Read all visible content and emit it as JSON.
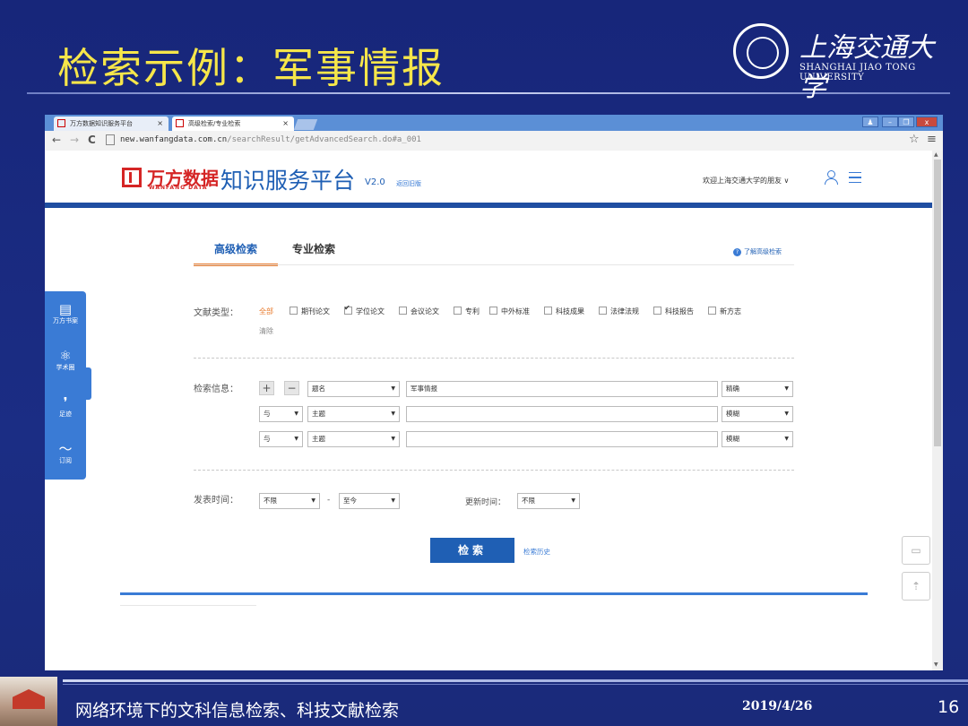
{
  "slide": {
    "title": "检索示例：军事情报",
    "logo_cn": "上海交通大学",
    "logo_en": "SHANGHAI JIAO TONG UNIVERSITY",
    "footer_text": "网络环境下的文科信息检索、科技文献检索",
    "footer_date": "2019/4/26",
    "page_number": "16"
  },
  "browser": {
    "tabs": [
      {
        "label": "万方数据知识服务平台",
        "close": "×"
      },
      {
        "label": "高级检索/专业检索",
        "close": "×"
      }
    ],
    "url_host": "new.wanfangdata.com.cn",
    "url_path": "/searchResult/getAdvancedSearch.do#a_001",
    "back": "←",
    "forward": "→",
    "reload": "C",
    "star": "☆",
    "menu": "≡"
  },
  "site": {
    "brand_cn": "万方数据",
    "brand_en": "WANFANG DATA",
    "platform": "知识服务平台",
    "version": "V2.0",
    "old_version_link": "返回旧版",
    "welcome": "欢迎上海交通大学的朋友 ∨"
  },
  "side_panel": {
    "items": [
      {
        "icon": "bookshelf-icon",
        "glyph": "▤",
        "label": "万方书案"
      },
      {
        "icon": "scholar-network-icon",
        "glyph": "⚛",
        "label": "学术圈"
      },
      {
        "icon": "footprint-icon",
        "glyph": "❜",
        "label": "足迹"
      },
      {
        "icon": "rss-icon",
        "glyph": "〜",
        "label": "订阅"
      }
    ]
  },
  "search_tabs": {
    "advanced": "高级检索",
    "professional": "专业检索",
    "help": "了解高级检索"
  },
  "doc_types": {
    "label": "文献类型：",
    "all": "全部",
    "clear": "清除",
    "options": [
      {
        "label": "期刊论文",
        "checked": false
      },
      {
        "label": "学位论文",
        "checked": true
      },
      {
        "label": "会议论文",
        "checked": false
      },
      {
        "label": "专利",
        "checked": false
      },
      {
        "label": "中外标准",
        "checked": false
      },
      {
        "label": "科技成果",
        "checked": false
      },
      {
        "label": "法律法规",
        "checked": false
      },
      {
        "label": "科技报告",
        "checked": false
      },
      {
        "label": "新方志",
        "checked": false
      }
    ]
  },
  "search_info": {
    "label": "检索信息：",
    "add": "+",
    "remove": "−",
    "rows": [
      {
        "logic": "",
        "field": "题名",
        "value": "军事情报",
        "match": "精确"
      },
      {
        "logic": "与",
        "field": "主题",
        "value": "",
        "match": "模糊"
      },
      {
        "logic": "与",
        "field": "主题",
        "value": "",
        "match": "模糊"
      }
    ]
  },
  "time": {
    "publish_label": "发表时间：",
    "from": "不限",
    "dash": "-",
    "to": "至今",
    "update_label": "更新时间：",
    "update_value": "不限"
  },
  "actions": {
    "search": "检索",
    "history": "检索历史"
  },
  "colors": {
    "slide_bg": "#1a2a7a",
    "title": "#f6e64a",
    "brand_red": "#d52525",
    "brand_blue": "#1f5fb4",
    "accent_orange": "#e87a2c"
  }
}
